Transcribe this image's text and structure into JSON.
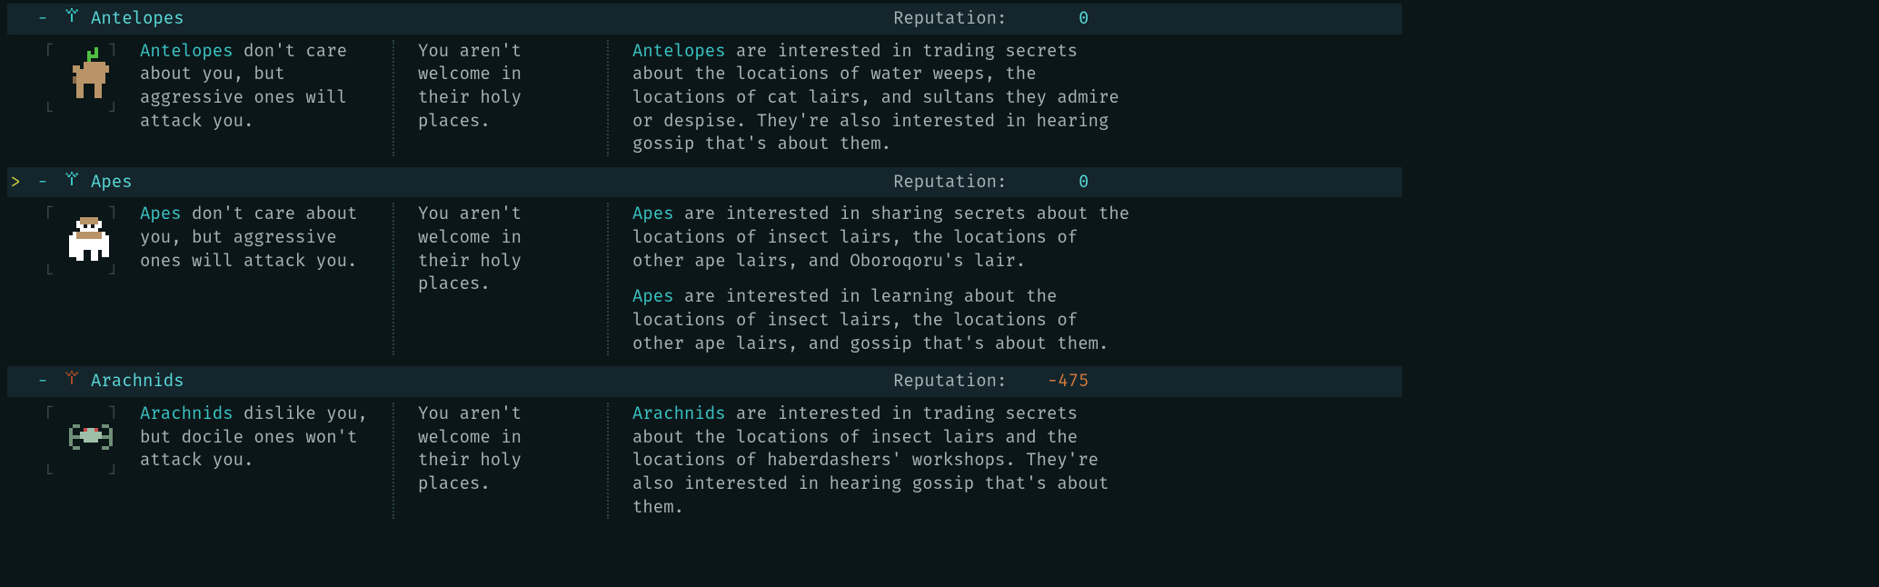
{
  "labels": {
    "reputation": "Reputation:",
    "collapse": "-",
    "selector": ">"
  },
  "factions": [
    {
      "id": "antelopes",
      "name": "Antelopes",
      "selected": false,
      "icon_color": "#3ac4c4",
      "rep": {
        "value": "0",
        "class": "rep-neutral"
      },
      "disposition_name": "Antelopes",
      "disposition_rest": " don't care about you, but aggressive ones will attack you.",
      "welcome": "You aren't welcome in their holy places.",
      "interests": [
        {
          "name": "Antelopes",
          "rest": " are interested in trading secrets about the locations of water weeps, the locations of cat lairs, and sultans they admire or despise. They're also interested in hearing gossip that's about them."
        }
      ],
      "sprite": "antelope"
    },
    {
      "id": "apes",
      "name": "Apes",
      "selected": true,
      "icon_color": "#3ac4c4",
      "rep": {
        "value": "0",
        "class": "rep-neutral"
      },
      "disposition_name": "Apes",
      "disposition_rest": " don't care about you, but aggressive ones will attack you.",
      "welcome": "You aren't welcome in their holy places.",
      "interests": [
        {
          "name": "Apes",
          "rest": " are interested in sharing secrets about the locations of insect lairs, the locations of other ape lairs, and Oboroqoru's lair."
        },
        {
          "name": "Apes",
          "rest": " are interested in learning about the locations of insect lairs, the locations of other ape lairs, and gossip that's about them."
        }
      ],
      "sprite": "ape"
    },
    {
      "id": "arachnids",
      "name": "Arachnids",
      "selected": false,
      "icon_color": "#a84a2a",
      "rep": {
        "value": "-475",
        "class": "rep-neg"
      },
      "disposition_name": "Arachnids",
      "disposition_rest": " dislike you, but docile ones won't attack you.",
      "welcome": "You aren't welcome in their holy places.",
      "interests": [
        {
          "name": "Arachnids",
          "rest": " are interested in trading secrets about the locations of insect lairs and the locations of haberdashers' workshops. They're also interested in hearing gossip that's about them."
        }
      ],
      "sprite": "spider"
    }
  ]
}
